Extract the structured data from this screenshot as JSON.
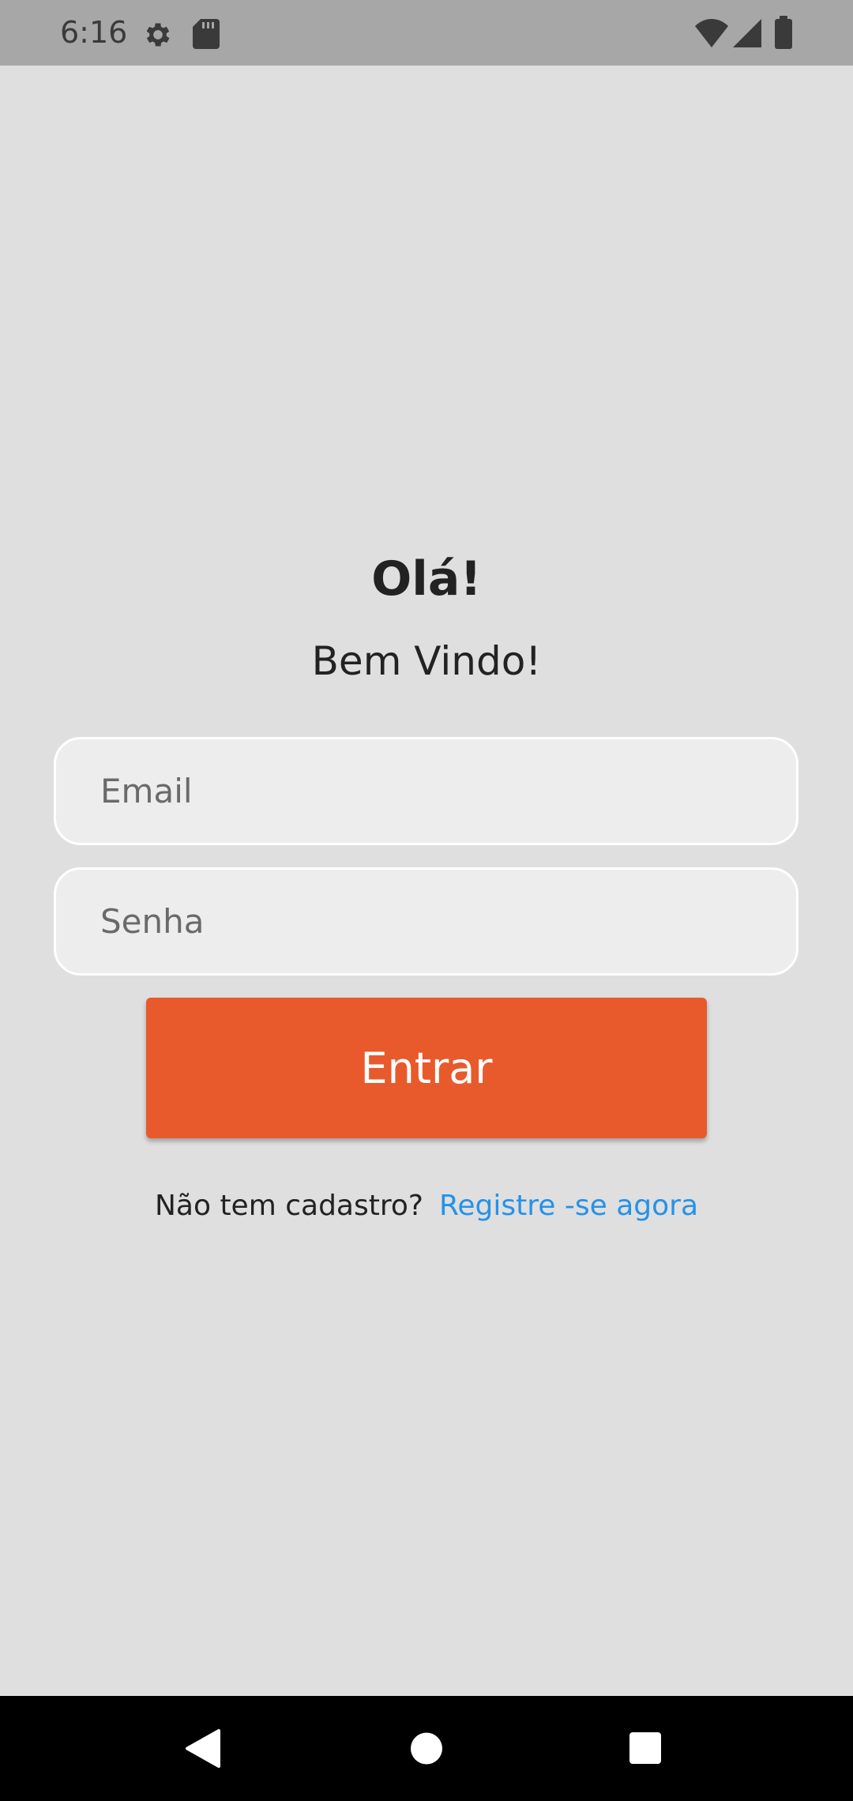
{
  "status_bar": {
    "time": "6:16",
    "icons": [
      "gear-icon",
      "sd-card-icon",
      "wifi-icon",
      "signal-icon",
      "battery-icon"
    ]
  },
  "login": {
    "greeting": "Olá!",
    "welcome": "Bem Vindo!",
    "email_placeholder": "Email",
    "password_placeholder": "Senha",
    "submit_label": "Entrar",
    "register_prompt": "Não tem cadastro?",
    "register_link": "Registre -se agora"
  },
  "nav_bar": {
    "buttons": [
      "back-icon",
      "home-icon",
      "recents-icon"
    ]
  },
  "colors": {
    "accent": "#e85a2b",
    "link": "#2592e8",
    "background": "#dfdfdf",
    "status_bar": "#a7a7a7"
  }
}
